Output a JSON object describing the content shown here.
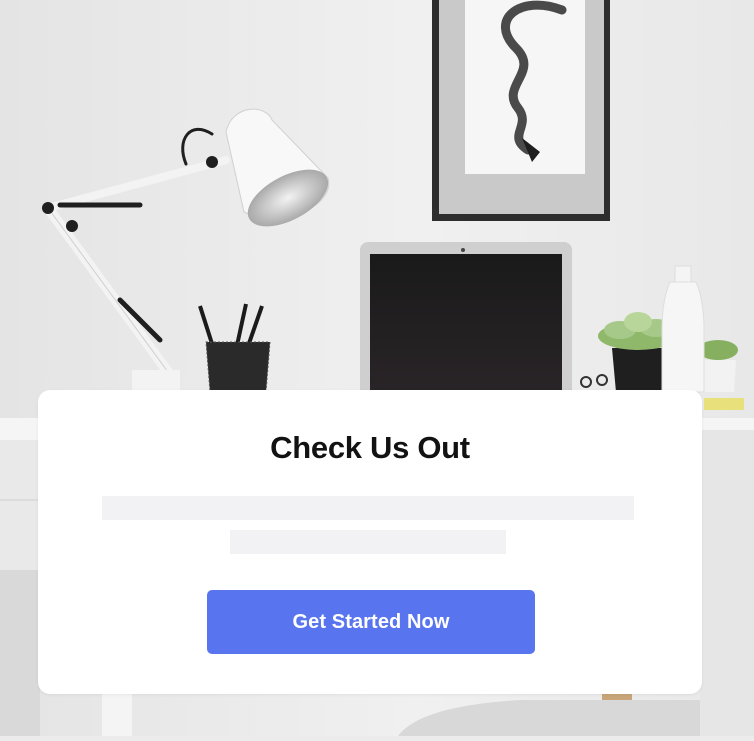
{
  "card": {
    "title": "Check Us Out",
    "cta_label": "Get Started Now"
  },
  "colors": {
    "cta_background": "#5974ef",
    "cta_text": "#ffffff",
    "skeleton": "#f2f2f4",
    "card_background": "#ffffff"
  },
  "icons": [
    "desk-lamp",
    "framed-art",
    "laptop",
    "pencil-cup",
    "succulent-plant",
    "vase"
  ]
}
